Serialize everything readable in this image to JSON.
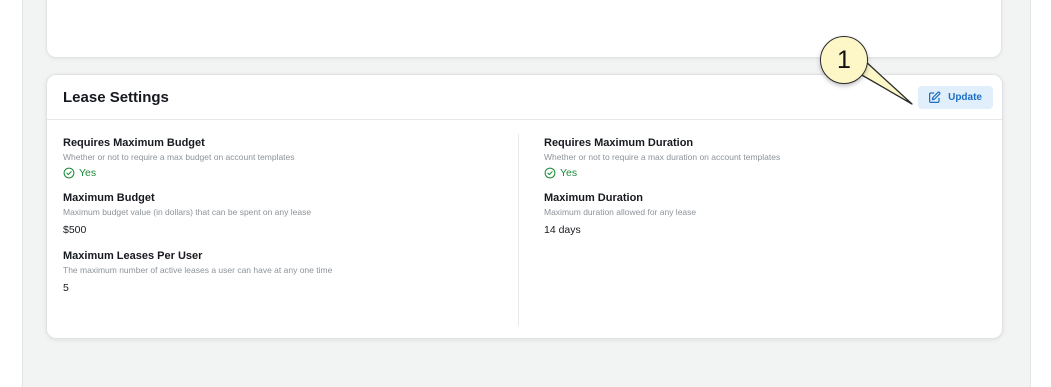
{
  "section": {
    "title": "Lease Settings",
    "update_label": "Update"
  },
  "fields": {
    "requires_max_budget": {
      "label": "Requires Maximum Budget",
      "desc": "Whether or not to require a max budget on account templates",
      "value": "Yes"
    },
    "max_budget": {
      "label": "Maximum Budget",
      "desc": "Maximum budget value (in dollars) that can be spent on any lease",
      "value": "$500"
    },
    "max_leases": {
      "label": "Maximum Leases Per User",
      "desc": "The maximum number of active leases a user can have at any one time",
      "value": "5"
    },
    "requires_max_duration": {
      "label": "Requires Maximum Duration",
      "desc": "Whether or not to require a max duration on account templates",
      "value": "Yes"
    },
    "max_duration": {
      "label": "Maximum Duration",
      "desc": "Maximum duration allowed for any lease",
      "value": "14 days"
    }
  },
  "annotation": {
    "number": "1"
  },
  "colors": {
    "accent": "#1d6fc4",
    "accent_bg": "#e1eefb",
    "success": "#1d8a3a",
    "callout_bg": "#fdf7c8"
  },
  "icons": {
    "update": "edit-icon",
    "yes": "check-circle-icon"
  }
}
